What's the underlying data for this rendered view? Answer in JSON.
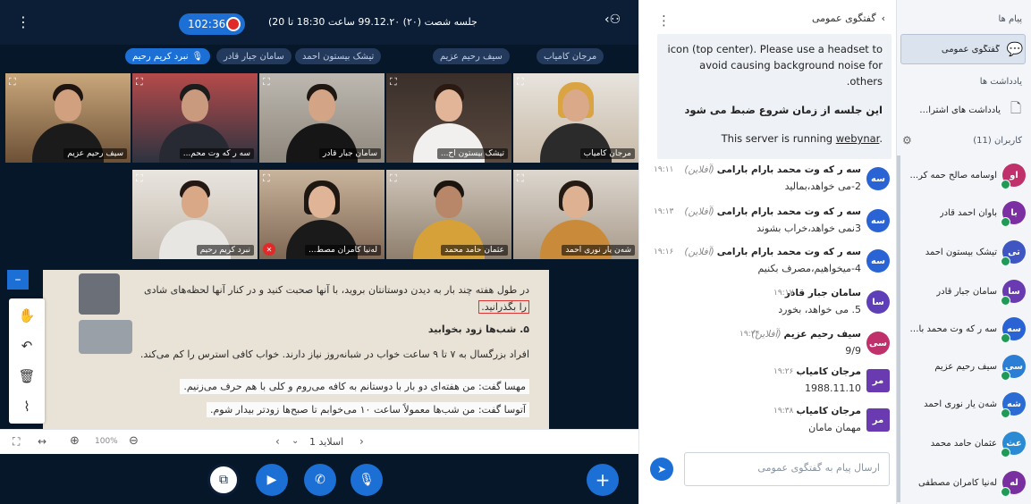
{
  "sidebar": {
    "messages_heading": "پیام ها",
    "public_chat": "گفتگوی عمومی",
    "notes_heading": "یادداشت ها",
    "shared_notes": "یادداشت های اشتراکی",
    "users_heading": "کاربران (11)",
    "users": [
      {
        "initials": "او",
        "name": "اوسامه صالح حمه کر...",
        "color": "#c0306a"
      },
      {
        "initials": "با",
        "name": "باوان احمد قادر",
        "color": "#7b2fa3"
      },
      {
        "initials": "تی",
        "name": "تیشک بیستون احمد",
        "color": "#3f56c2"
      },
      {
        "initials": "سا",
        "name": "سامان جبار قادر",
        "color": "#6a3bb0"
      },
      {
        "initials": "سه",
        "name": "سه ر که وت محمد بار...",
        "color": "#2a63d4"
      },
      {
        "initials": "سی",
        "name": "سیف رحیم عزیم",
        "color": "#2a7fd4"
      },
      {
        "initials": "شه",
        "name": "شەن یار نوری احمد",
        "color": "#2a6bd4"
      },
      {
        "initials": "عث",
        "name": "عثمان حامد محمد",
        "color": "#2a8ad4"
      },
      {
        "initials": "له",
        "name": "لەنیا کامران مصطفی",
        "color": "#7a2fa0"
      }
    ]
  },
  "chat": {
    "title": "گفتگوی عمومی",
    "pinned": {
      "line1": "icon (top center). Please use a headset to",
      "line2": "avoid causing background noise for others.",
      "line3": "این جلسه از زمان شروع ضبط می شود",
      "line4_prefix": "This server is running ",
      "line4_link": "webynar",
      "line4_suffix": "."
    },
    "messages": [
      {
        "initials": "سه",
        "color": "#2a63d4",
        "name": "سه ر که وت محمد بارام بارامی",
        "status": "(آفلاین)",
        "time": "۱۹:۱۱",
        "text": "2-می خواهد،بمالید"
      },
      {
        "initials": "سه",
        "color": "#2a63d4",
        "name": "سه ر که وت محمد بارام بارامی",
        "status": "(آفلاین)",
        "time": "۱۹:۱۳",
        "text": "3نمی خواهد،خراب بشوند"
      },
      {
        "initials": "سه",
        "color": "#2a63d4",
        "name": "سه ر که وت محمد بارام بارامی",
        "status": "(آفلاین)",
        "time": "۱۹:۱۶",
        "text": "4-میخواهیم،مصرف بکنیم"
      },
      {
        "initials": "سا",
        "color": "#5e3fb8",
        "name": "سامان جبار قادر",
        "status": "",
        "time": "۱۹:۱۷",
        "text": "5. می خواهد، بخورد"
      },
      {
        "initials": "سی",
        "color": "#c0306a",
        "name": "سیف رحیم عزیم",
        "status": "(آفلاین)",
        "time": "۱۹:۲۴",
        "text": "9/9"
      },
      {
        "initials": "مر",
        "color": "#6a3bb0",
        "name": "مرجان کامیاب",
        "status": "",
        "time": "۱۹:۲۶",
        "text": "1988.11.10"
      },
      {
        "initials": "مر",
        "color": "#6a3bb0",
        "name": "مرجان کامیاب",
        "status": "",
        "time": "۱۹:۳۸",
        "text": "مهمان مامان"
      }
    ],
    "input_placeholder": "ارسال پیام به گفتگوی عمومی"
  },
  "stage": {
    "timer": "102:36",
    "title": "جلسه شصت (۲۰) 99.12.۲۰ ساعت 18:30 تا 20)",
    "talking": "نبرد کریم رحیم",
    "chips": [
      "مرجان کامیاب",
      "سیف رحیم عزیم",
      "تیشک بیستون احمد",
      "سامان جبار قادر"
    ],
    "tiles_row1": [
      "مرجان کامیاب",
      "تیشک بیستون اح...",
      "سامان جبار قادر",
      "سه ر که وت محم...",
      "سیف رحیم عزیم"
    ],
    "tiles_row2": [
      "شەن یار نوری احمد",
      "عثمان حامد محمد",
      "لەنیا کامران مصط...",
      "نبرد کریم رحیم"
    ],
    "slide_lines": [
      "در طول هفته چند بار به دیدن دوستانتان بروید، با آنها صحبت کنید و در کنار آنها لحظه‌های شادی",
      "را بگذرانید.",
      "۵. شب‌ها زود بخوابید",
      "افراد بزرگسال به ۷ تا ۹ ساعت خواب در شبانه‌روز نیاز دارند. خواب کافی استرس را کم می‌کند.",
      "مهسا گفت:   من هفته‌ای دو بار با دوستانم به کافه می‌روم و کلی با هم حرف می‌زنیم.",
      "آتوسا گفت:   من شب‌ها معمولاً ساعت ۱۰ می‌خوابم تا صبح‌ها زودتر بیدار شوم."
    ],
    "slide_label": "اسلاید 1",
    "zoom": "100%"
  }
}
